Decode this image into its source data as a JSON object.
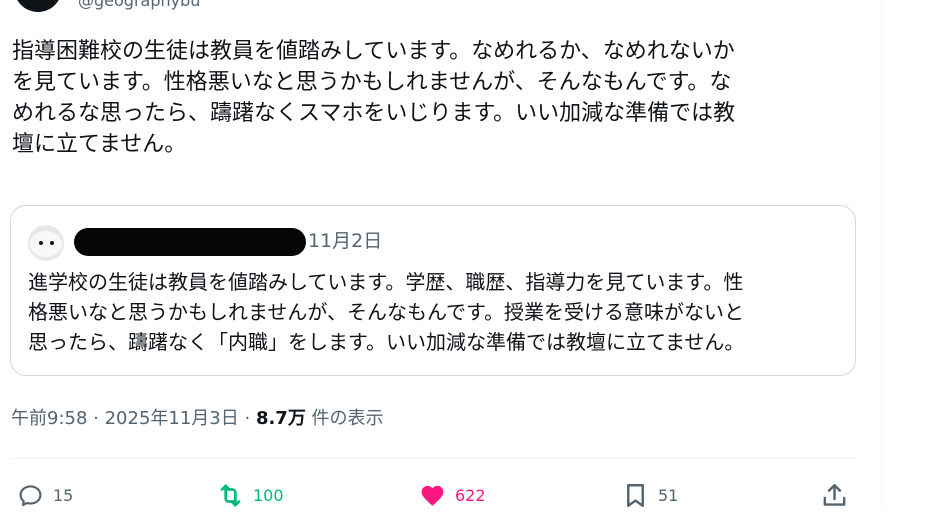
{
  "author": {
    "handle": "@geographybu"
  },
  "tweet": {
    "text": "指導困難校の生徒は教員を値踏みしています。なめれるか、なめれないか\nを見ています。性格悪いなと思うかもしれませんが、そんなもんです。な\nめれるな思ったら、躊躇なくスマホをいじります。いい加減な準備では教\n壇に立てません。"
  },
  "quote": {
    "date": "11月2日",
    "text": "進学校の生徒は教員を値踏みしています。学歴、職歴、指導力を見ています。性\n格悪いなと思うかもしれませんが、そんなもんです。授業を受ける意味がないと\n思ったら、躊躇なく「内職」をします。いい加減な準備では教壇に立てません。"
  },
  "meta": {
    "time": "午前9:58",
    "sep1": " · ",
    "date": "2025年11月3日",
    "sep2": " · ",
    "views_count": "8.7万",
    "views_label": " 件の表示"
  },
  "actions": {
    "replies": "15",
    "reposts": "100",
    "likes": "622",
    "bookmarks": "51"
  },
  "colors": {
    "repost_active": "#00ba7c",
    "like_active": "#f91880",
    "muted": "#536471"
  }
}
